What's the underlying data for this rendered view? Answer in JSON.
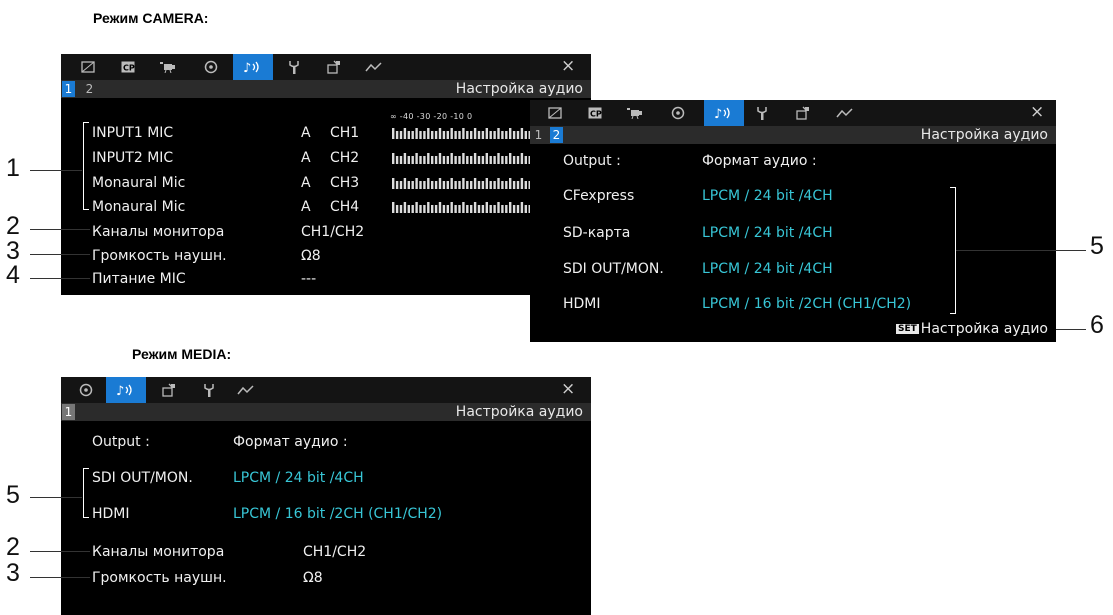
{
  "headings": {
    "camera": "Режим CAMERA:",
    "media": "Режим MEDIA:"
  },
  "icons": {
    "tabs_camera": [
      "frame-icon",
      "cp-icon",
      "camera-icon",
      "disc-icon",
      "audio-icon",
      "wrench-icon",
      "custom-icon",
      "assist-icon"
    ],
    "tabs_media": [
      "disc-icon",
      "audio-icon",
      "custom-icon",
      "wrench-icon",
      "assist-icon"
    ],
    "close": "close-icon",
    "headphone": "headphone-icon"
  },
  "common": {
    "screen_title": "Настройка аудио",
    "close": "×"
  },
  "screen1": {
    "pages": [
      "1",
      "2"
    ],
    "meter_scale": "∞ -40  -30  -20  -10   0",
    "rows": [
      {
        "label": "INPUT1 MIC",
        "mode": "A",
        "ch": "CH1"
      },
      {
        "label": "INPUT2 MIC",
        "mode": "A",
        "ch": "CH2"
      },
      {
        "label": "Monaural Mic",
        "mode": "A",
        "ch": "CH3"
      },
      {
        "label": "Monaural Mic",
        "mode": "A",
        "ch": "CH4"
      }
    ],
    "monitor_label": "Каналы монитора",
    "monitor_value": "CH1/CH2",
    "headphone_label": "Громкость наушн.",
    "headphone_value": "8",
    "mic_power_label": "Питание MIC",
    "mic_power_value": "---"
  },
  "screen2": {
    "pages": [
      "1",
      "2"
    ],
    "output_header": "Output :",
    "format_header": "Формат аудио :",
    "rows": [
      {
        "label": "CFexpress",
        "value": "LPCM / 24 bit /4CH"
      },
      {
        "label": "SD-карта",
        "value": "LPCM / 24 bit /4CH"
      },
      {
        "label": "SDI OUT/MON.",
        "value": "LPCM / 24 bit /4CH"
      },
      {
        "label": "HDMI",
        "value": "LPCM / 16 bit /2CH (CH1/CH2)"
      }
    ],
    "set_badge": "SET",
    "set_label": "Настройка аудио"
  },
  "screen3": {
    "pages": [
      "1"
    ],
    "output_header": "Output :",
    "format_header": "Формат аудио :",
    "rows": [
      {
        "label": "SDI OUT/MON.",
        "value": "LPCM / 24 bit /4CH"
      },
      {
        "label": "HDMI",
        "value": "LPCM / 16 bit /2CH (CH1/CH2)"
      }
    ],
    "monitor_label": "Каналы монитора",
    "monitor_value": "CH1/CH2",
    "headphone_label": "Громкость наушн.",
    "headphone_value": "8"
  },
  "callouts": {
    "c1": "1",
    "c2": "2",
    "c3": "3",
    "c4": "4",
    "c5": "5",
    "c6": "6",
    "m5": "5",
    "m2": "2",
    "m3": "3"
  },
  "colors": {
    "accent": "#1a7bd4",
    "value_cyan": "#38c6d6"
  }
}
